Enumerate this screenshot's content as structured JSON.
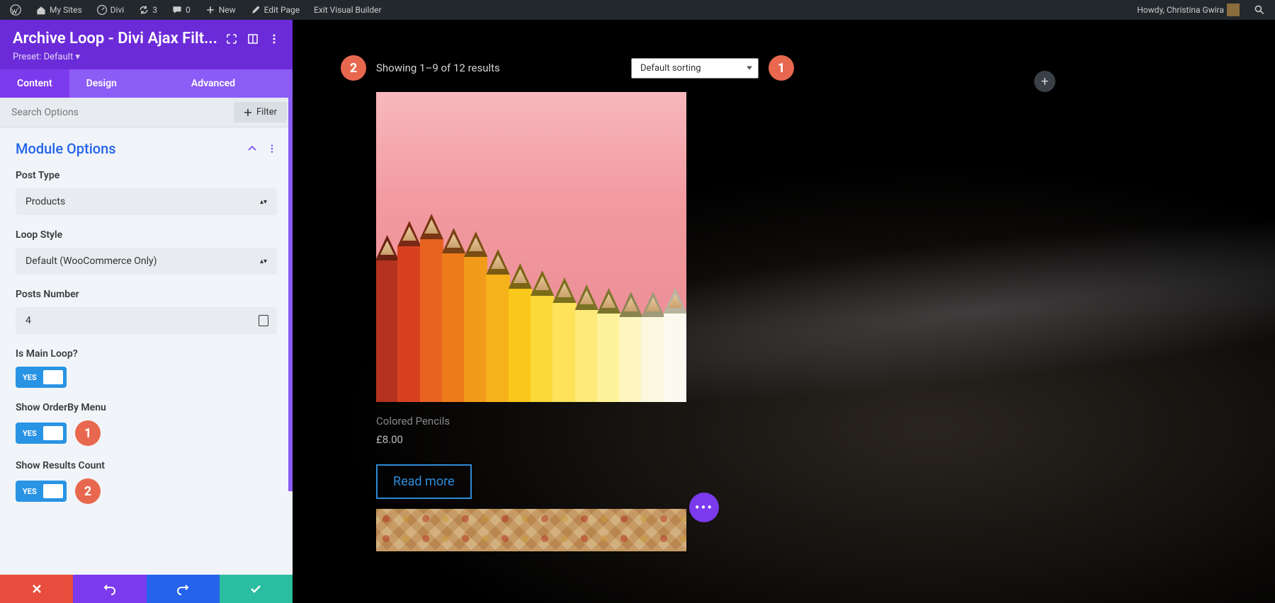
{
  "wpbar": {
    "mysites": "My Sites",
    "site": "Divi",
    "updates": "3",
    "comments": "0",
    "new": "New",
    "edit": "Edit Page",
    "exit": "Exit Visual Builder",
    "howdy": "Howdy, Christina Gwira"
  },
  "sidebar": {
    "title": "Archive Loop - Divi Ajax Filt...",
    "preset": "Preset: Default ▾",
    "tabs": {
      "content": "Content",
      "design": "Design",
      "advanced": "Advanced"
    },
    "search_placeholder": "Search Options",
    "filter_btn": "Filter",
    "section_title": "Module Options",
    "fields": {
      "post_type_label": "Post Type",
      "post_type_value": "Products",
      "loop_style_label": "Loop Style",
      "loop_style_value": "Default (WooCommerce Only)",
      "posts_number_label": "Posts Number",
      "posts_number_value": "4",
      "main_loop_label": "Is Main Loop?",
      "orderby_label": "Show OrderBy Menu",
      "results_label": "Show Results Count",
      "toggle_yes": "YES"
    },
    "badges": {
      "orderby": "1",
      "results": "2"
    }
  },
  "canvas": {
    "results_badge": "2",
    "results_text": "Showing 1–9 of 12 results",
    "sort_value": "Default sorting",
    "sort_badge": "1",
    "product": {
      "title": "Colored Pencils",
      "price": "£8.00",
      "button": "Read more"
    },
    "add": "+",
    "menu": "•••"
  }
}
